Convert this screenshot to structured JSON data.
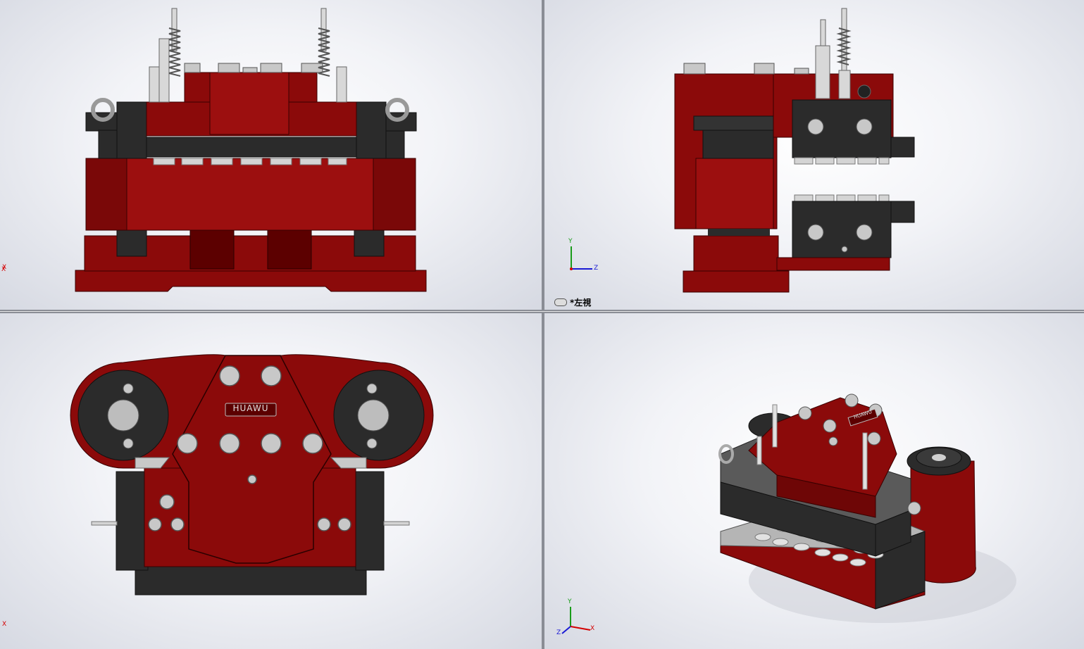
{
  "viewports": {
    "front": {
      "triad": {
        "x_label": "X"
      }
    },
    "left": {
      "label": "*左視",
      "triad": {
        "y_label": "Y",
        "z_label": "Z"
      }
    },
    "top": {
      "brand": "HUAWU",
      "triad": {
        "x_label": "X"
      }
    },
    "iso": {
      "brand": "HUAWU",
      "triad": {
        "x_label": "X",
        "y_label": "Y",
        "z_label": "Z"
      }
    }
  },
  "colors": {
    "part_red": "#8b0a0a",
    "part_dark_red": "#5c0000",
    "steel_dark": "#2b2b2b",
    "steel_light": "#c8c8c8",
    "axis_x": "#d40000",
    "axis_y": "#1a9c1a",
    "axis_z": "#1a1ad4"
  },
  "icons": [
    "link-view-icon",
    "axis-triad-icon",
    "eyebolt-icon"
  ]
}
